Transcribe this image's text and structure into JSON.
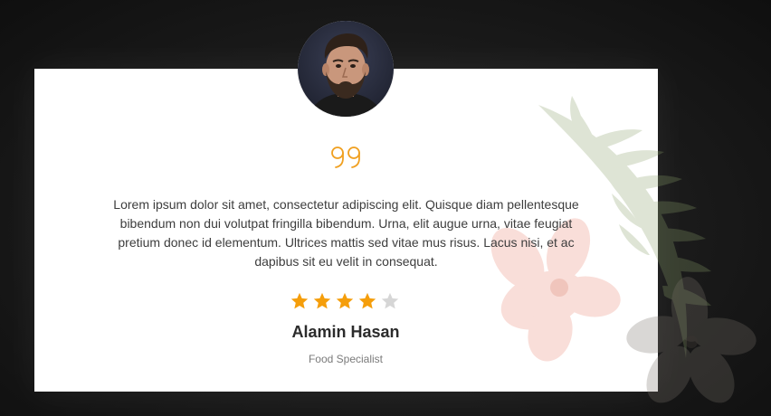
{
  "testimonial": {
    "text": "Lorem ipsum dolor sit amet, consectetur adipiscing elit. Quisque diam pellentesque bibendum non dui volutpat fringilla bibendum. Urna, elit augue urna, vitae feugiat pretium donec id elementum. Ultrices mattis sed vitae mus risus. Lacus nisi, et ac dapibus sit eu velit in consequat.",
    "rating": 4,
    "rating_max": 5,
    "name": "Alamin Hasan",
    "role": "Food Specialist"
  },
  "icons": {
    "quote": "quote-icon",
    "star": "star-icon"
  },
  "colors": {
    "background": "#1a1a1a",
    "card": "#ffffff",
    "accent": "#f0a021",
    "star_filled": "#f59e0b",
    "star_empty": "#d6d6d6",
    "text": "#3d3d3d",
    "name": "#2b2b2b",
    "role": "#7a7a7a"
  }
}
